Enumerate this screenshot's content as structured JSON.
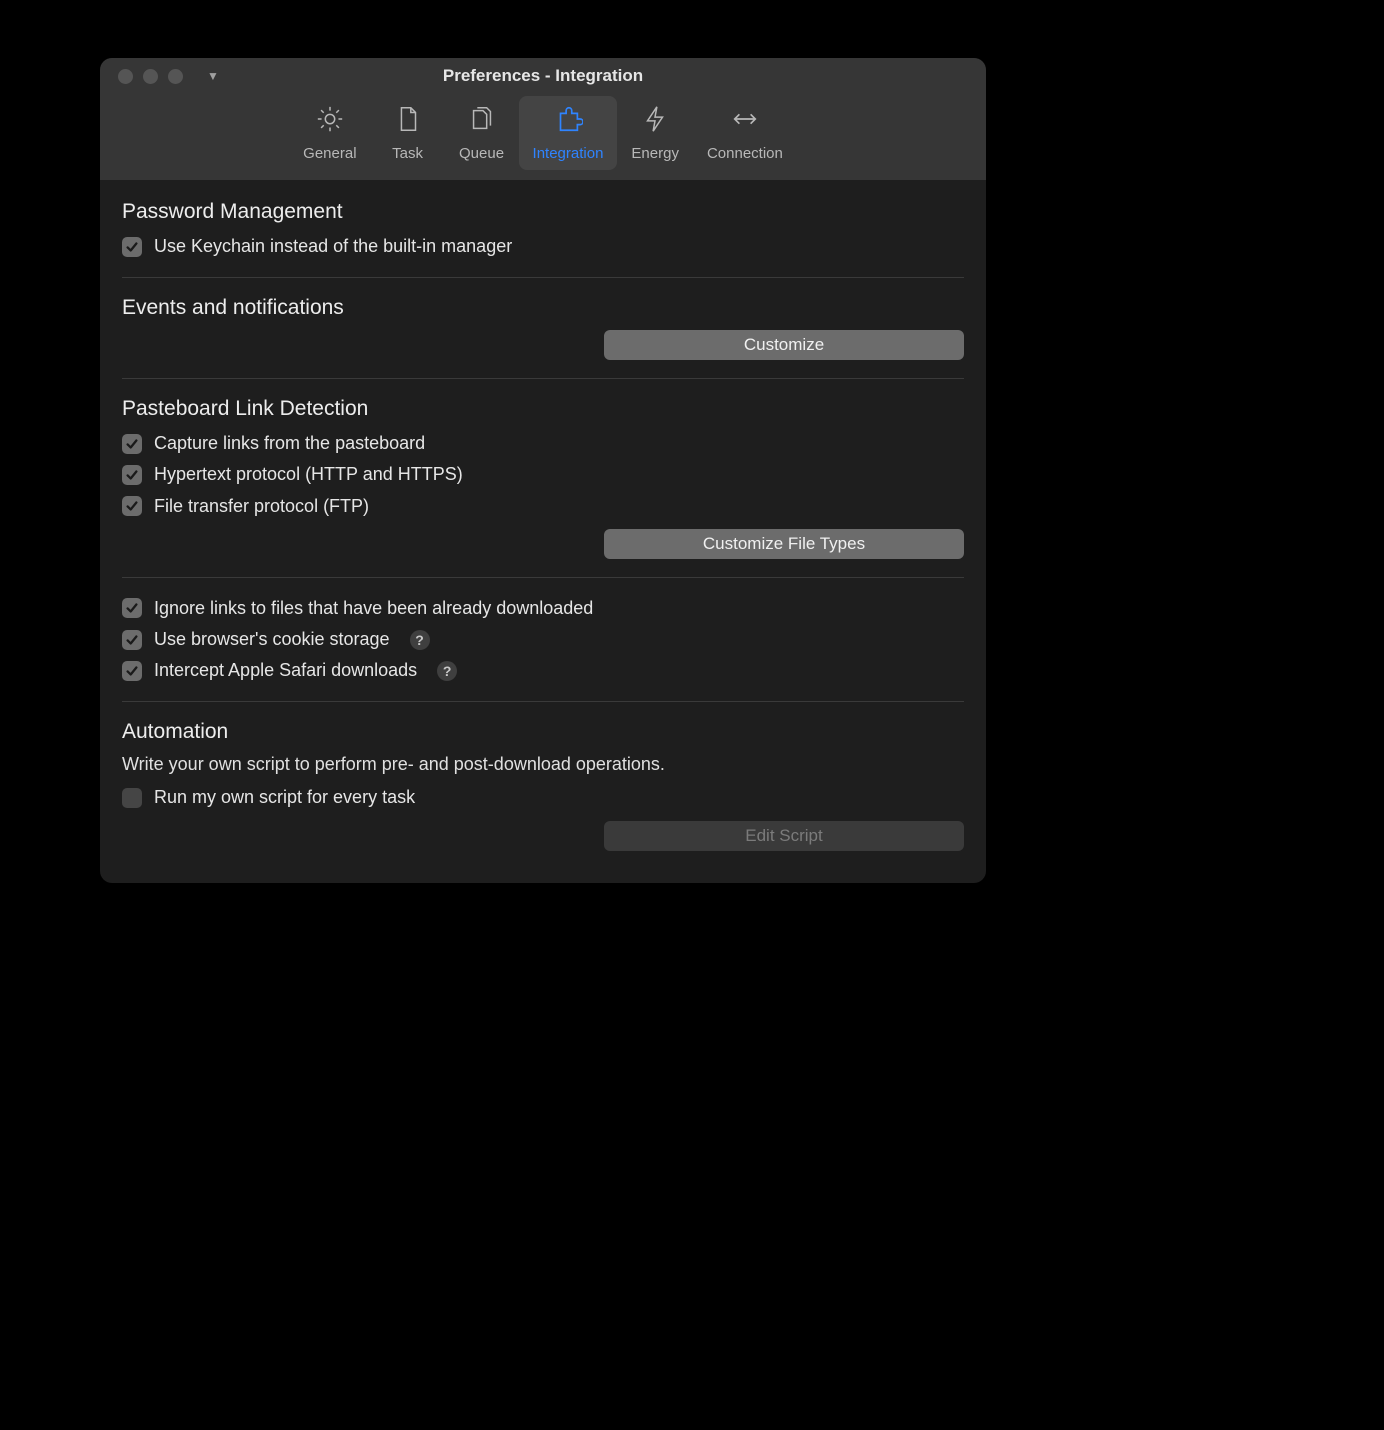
{
  "window": {
    "title": "Preferences - Integration"
  },
  "toolbar": {
    "items": [
      {
        "id": "general",
        "label": "General"
      },
      {
        "id": "task",
        "label": "Task"
      },
      {
        "id": "queue",
        "label": "Queue"
      },
      {
        "id": "integration",
        "label": "Integration",
        "selected": true
      },
      {
        "id": "energy",
        "label": "Energy"
      },
      {
        "id": "connection",
        "label": "Connection"
      }
    ]
  },
  "sections": {
    "password": {
      "title": "Password Management",
      "use_keychain": {
        "label": "Use Keychain instead of the built-in manager",
        "checked": true
      }
    },
    "events": {
      "title": "Events and notifications",
      "customize_btn": "Customize"
    },
    "pasteboard": {
      "title": "Pasteboard Link Detection",
      "capture": {
        "label": "Capture links from the pasteboard",
        "checked": true
      },
      "http": {
        "label": "Hypertext protocol (HTTP and HTTPS)",
        "checked": true
      },
      "ftp": {
        "label": "File transfer protocol (FTP)",
        "checked": true
      },
      "file_types_btn": "Customize File Types",
      "ignore": {
        "label": "Ignore links to files that have been already downloaded",
        "checked": true
      },
      "cookies": {
        "label": "Use browser's cookie storage",
        "checked": true
      },
      "safari": {
        "label": "Intercept Apple Safari downloads",
        "checked": true
      }
    },
    "automation": {
      "title": "Automation",
      "desc": "Write your own script to perform pre- and post-download operations.",
      "run_script": {
        "label": "Run my own script for every task",
        "checked": false
      },
      "edit_btn": "Edit Script"
    }
  }
}
